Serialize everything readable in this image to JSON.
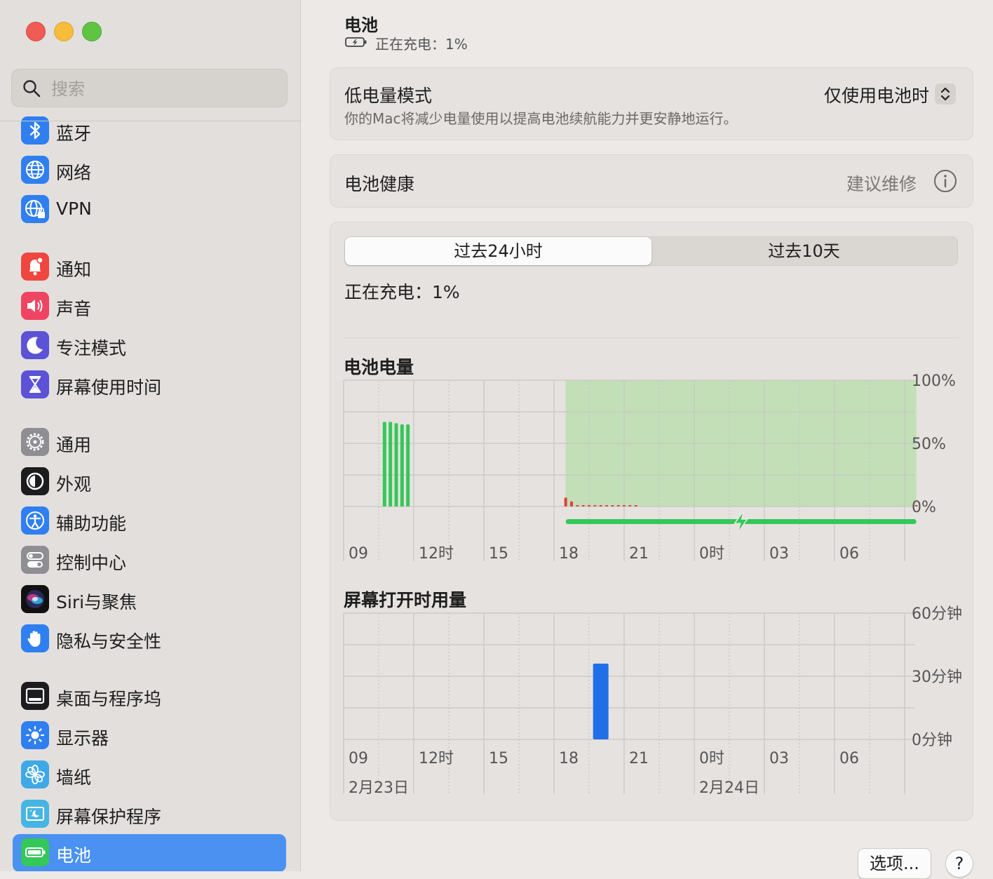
{
  "window": {
    "title": "电池"
  },
  "search": {
    "placeholder": "搜索"
  },
  "sidebar": {
    "items": [
      {
        "label": "蓝牙",
        "icon": "bluetooth-icon"
      },
      {
        "label": "网络",
        "icon": "globe-icon"
      },
      {
        "label": "VPN",
        "icon": "vpn-globe-icon"
      },
      {
        "label": "通知",
        "icon": "bell-icon"
      },
      {
        "label": "声音",
        "icon": "speaker-icon"
      },
      {
        "label": "专注模式",
        "icon": "moon-icon"
      },
      {
        "label": "屏幕使用时间",
        "icon": "hourglass-icon"
      },
      {
        "label": "通用",
        "icon": "gear-icon"
      },
      {
        "label": "外观",
        "icon": "appearance-icon"
      },
      {
        "label": "辅助功能",
        "icon": "accessibility-icon"
      },
      {
        "label": "控制中心",
        "icon": "toggles-icon"
      },
      {
        "label": "Siri与聚焦",
        "icon": "siri-icon"
      },
      {
        "label": "隐私与安全性",
        "icon": "hand-icon"
      },
      {
        "label": "桌面与程序坞",
        "icon": "dock-icon"
      },
      {
        "label": "显示器",
        "icon": "sun-icon"
      },
      {
        "label": "墙纸",
        "icon": "flower-icon"
      },
      {
        "label": "屏幕保护程序",
        "icon": "screensaver-icon"
      },
      {
        "label": "电池",
        "icon": "battery-icon",
        "active": true
      }
    ]
  },
  "header": {
    "title": "电池",
    "status": "正在充电：1%"
  },
  "low_power": {
    "title": "低电量模式",
    "description": "你的Mac将减少电量使用以提高电池续航能力并更安静地运行。",
    "value": "仅使用电池时"
  },
  "battery_health": {
    "title": "电池健康",
    "value": "建议维修"
  },
  "tabs": [
    {
      "label": "过去24小时",
      "selected": true
    },
    {
      "label": "过去10天",
      "selected": false
    }
  ],
  "charging_status": "正在充电：1%",
  "colors": {
    "accent": "#4a91f1",
    "battery_bar": "#34c759",
    "low_battery": "#e0403a",
    "charging_fill": "#c2dfb8",
    "screen_bar": "#1f6fe8"
  },
  "chart_data": [
    {
      "type": "bar",
      "title": "电池电量",
      "x_ticks": [
        "09",
        "12时",
        "15",
        "18",
        "21",
        "0时",
        "03",
        "06"
      ],
      "y_ticks": [
        "100%",
        "50%",
        "0%"
      ],
      "ylim": [
        0,
        100
      ],
      "battery_bars": [
        {
          "hour": 10.75,
          "value": 67
        },
        {
          "hour": 11.0,
          "value": 67
        },
        {
          "hour": 11.25,
          "value": 66
        },
        {
          "hour": 11.5,
          "value": 65
        },
        {
          "hour": 11.75,
          "value": 65
        }
      ],
      "low_bars": [
        {
          "hour": 18.5,
          "value": 7
        },
        {
          "hour": 18.75,
          "value": 4
        },
        {
          "hour": 19.0,
          "value": 1
        },
        {
          "hour": 19.25,
          "value": 1
        },
        {
          "hour": 19.5,
          "value": 1
        },
        {
          "hour": 19.75,
          "value": 1
        },
        {
          "hour": 20.0,
          "value": 1
        },
        {
          "hour": 20.25,
          "value": 1
        },
        {
          "hour": 20.5,
          "value": 1
        },
        {
          "hour": 20.75,
          "value": 1
        },
        {
          "hour": 21.0,
          "value": 1
        },
        {
          "hour": 21.25,
          "value": 1
        },
        {
          "hour": 21.5,
          "value": 1
        },
        {
          "hour": 33.5,
          "value": 1
        }
      ],
      "charging_period": {
        "start_hour": 18.5,
        "end_hour": 33.5
      },
      "grid": true
    },
    {
      "type": "bar",
      "title": "屏幕打开时用量",
      "x_ticks": [
        "09",
        "12时",
        "15",
        "18",
        "21",
        "0时",
        "03",
        "06"
      ],
      "date_labels": [
        {
          "hour": 9,
          "label": "2月23日"
        },
        {
          "hour": 24,
          "label": "2月24日"
        }
      ],
      "y_ticks": [
        "60分钟",
        "30分钟",
        "0分钟"
      ],
      "ylim": [
        0,
        60
      ],
      "bars": [
        {
          "hour": 20.0,
          "minutes": 36
        }
      ],
      "grid": true
    }
  ],
  "footer": {
    "options_label": "选项...",
    "help_label": "?"
  }
}
